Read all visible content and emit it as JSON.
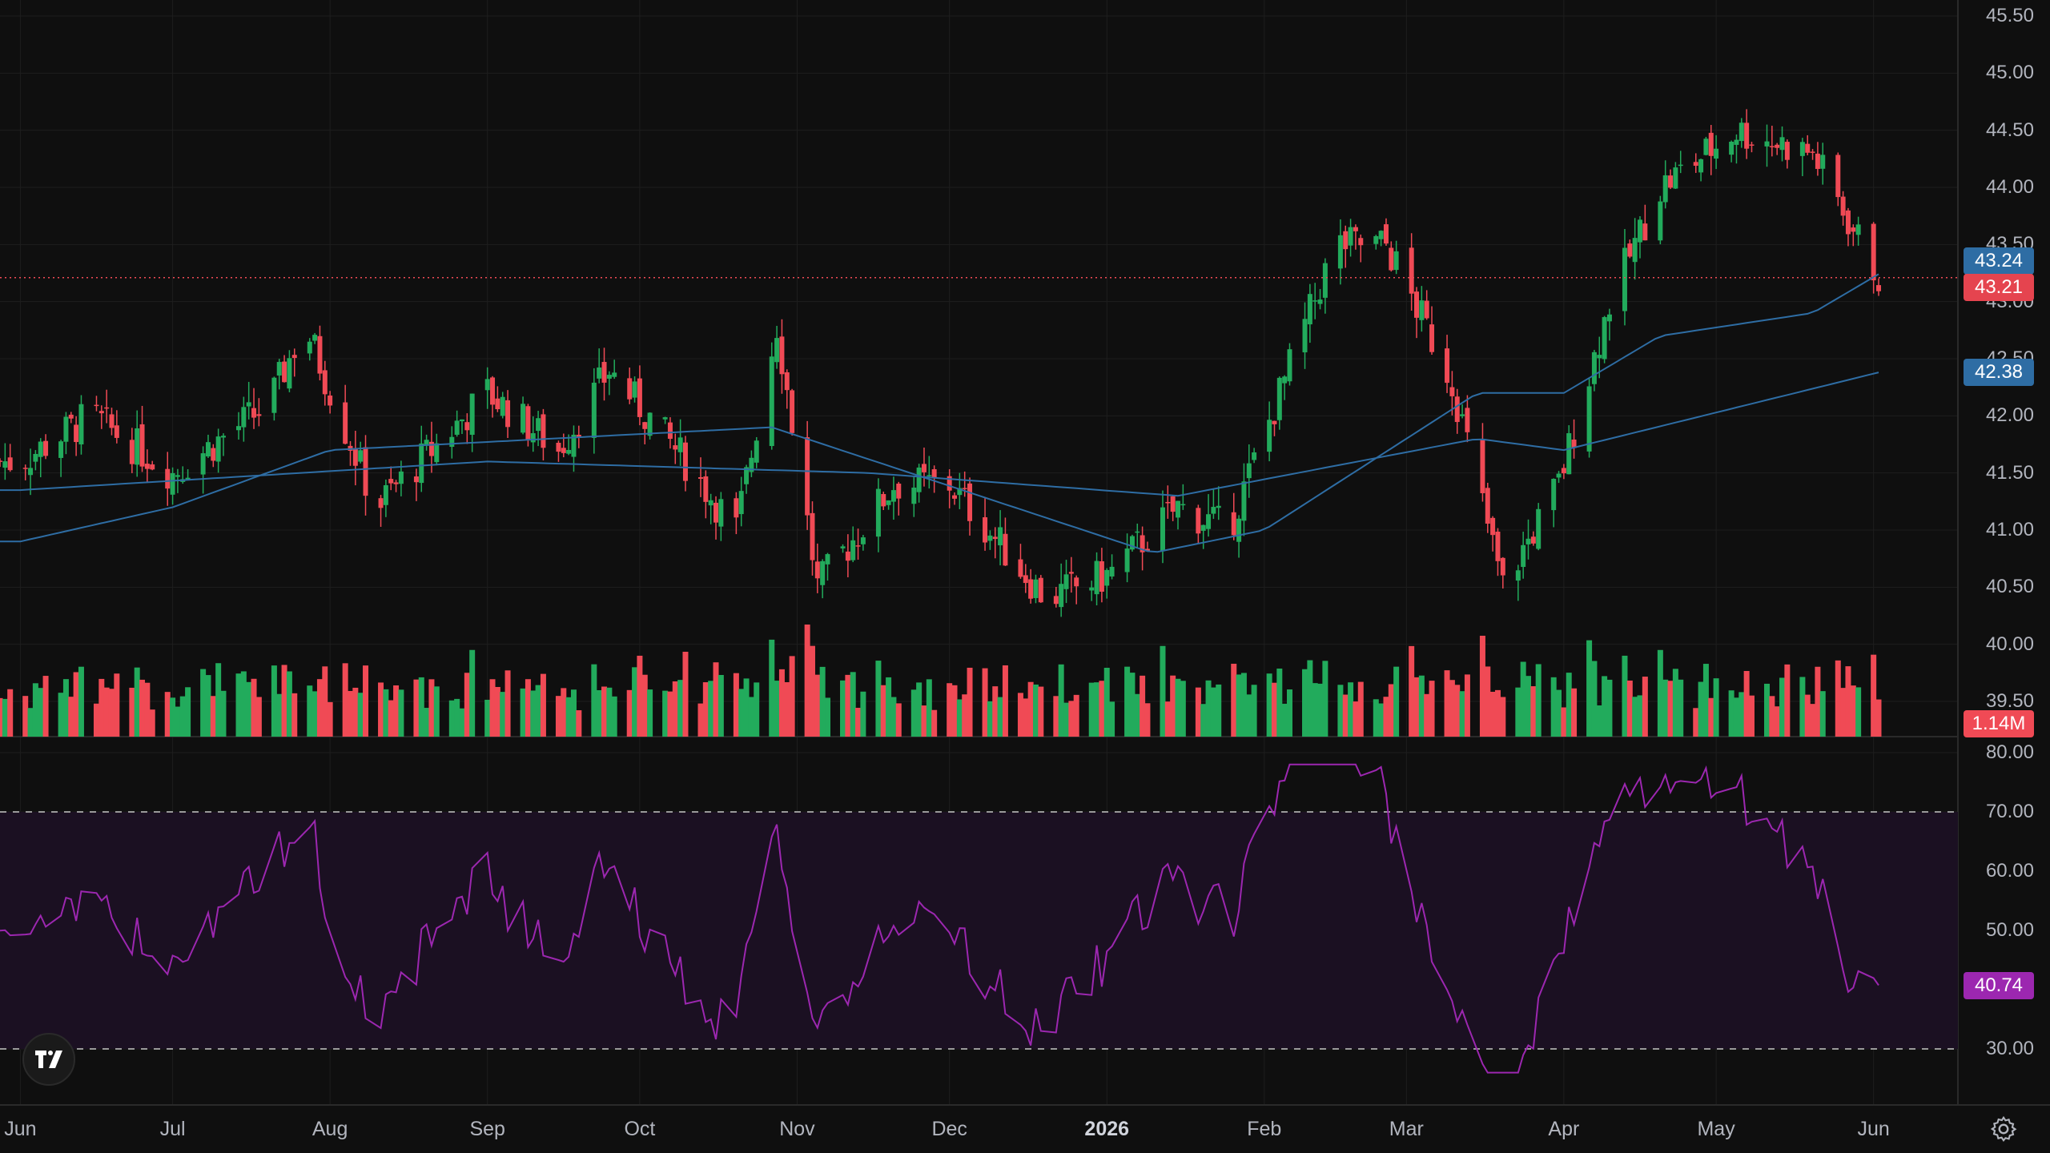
{
  "chart_data": [
    {
      "type": "candlestick",
      "title": "",
      "ylim": [
        39.2,
        45.6
      ],
      "y_ticks": [
        "45.50",
        "45.00",
        "44.50",
        "44.00",
        "43.50",
        "43.00",
        "42.50",
        "42.00",
        "41.50",
        "41.00",
        "40.50",
        "40.00",
        "39.50"
      ],
      "x_ticks": [
        "Jun",
        "Jul",
        "Aug",
        "Sep",
        "Oct",
        "Nov",
        "Dec",
        "2026",
        "Feb",
        "Mar",
        "Apr",
        "May",
        "Jun"
      ],
      "close_series_anchors": [
        {
          "date": "2025-06-01",
          "close": 41.6
        },
        {
          "date": "2025-06-15",
          "close": 42.0
        },
        {
          "date": "2025-07-01",
          "close": 41.5
        },
        {
          "date": "2025-07-20",
          "close": 42.1
        },
        {
          "date": "2025-07-27",
          "close": 42.8
        },
        {
          "date": "2025-08-10",
          "close": 41.2
        },
        {
          "date": "2025-09-01",
          "close": 42.2
        },
        {
          "date": "2025-09-15",
          "close": 41.7
        },
        {
          "date": "2025-09-25",
          "close": 42.4
        },
        {
          "date": "2025-10-10",
          "close": 41.6
        },
        {
          "date": "2025-10-20",
          "close": 41.0
        },
        {
          "date": "2025-10-28",
          "close": 42.8
        },
        {
          "date": "2025-11-05",
          "close": 40.5
        },
        {
          "date": "2025-11-20",
          "close": 41.4
        },
        {
          "date": "2025-12-01",
          "close": 41.4
        },
        {
          "date": "2025-12-20",
          "close": 40.4
        },
        {
          "date": "2026-01-01",
          "close": 40.6
        },
        {
          "date": "2026-01-15",
          "close": 41.2
        },
        {
          "date": "2026-01-25",
          "close": 41.0
        },
        {
          "date": "2026-02-15",
          "close": 43.5
        },
        {
          "date": "2026-02-25",
          "close": 43.5
        },
        {
          "date": "2026-03-10",
          "close": 42.3
        },
        {
          "date": "2026-03-20",
          "close": 40.5
        },
        {
          "date": "2026-03-31",
          "close": 41.4
        },
        {
          "date": "2026-04-10",
          "close": 43.0
        },
        {
          "date": "2026-04-20",
          "close": 44.0
        },
        {
          "date": "2026-05-05",
          "close": 44.5
        },
        {
          "date": "2026-05-20",
          "close": 44.3
        },
        {
          "date": "2026-06-02",
          "close": 43.21
        }
      ],
      "ma_fast_anchors": [
        {
          "date": "2025-06-01",
          "value": 40.9
        },
        {
          "date": "2025-07-01",
          "value": 41.2
        },
        {
          "date": "2025-08-01",
          "value": 41.7
        },
        {
          "date": "2025-10-27",
          "value": 41.9
        },
        {
          "date": "2026-01-10",
          "value": 40.8
        },
        {
          "date": "2026-02-01",
          "value": 41.0
        },
        {
          "date": "2026-03-15",
          "value": 42.2
        },
        {
          "date": "2026-04-01",
          "value": 42.2
        },
        {
          "date": "2026-04-20",
          "value": 42.7
        },
        {
          "date": "2026-05-20",
          "value": 42.9
        },
        {
          "date": "2026-06-02",
          "value": 43.24
        }
      ],
      "ma_slow_anchors": [
        {
          "date": "2025-06-01",
          "value": 41.35
        },
        {
          "date": "2025-09-01",
          "value": 41.6
        },
        {
          "date": "2025-11-15",
          "value": 41.5
        },
        {
          "date": "2026-01-15",
          "value": 41.3
        },
        {
          "date": "2026-03-15",
          "value": 41.8
        },
        {
          "date": "2026-04-01",
          "value": 41.7
        },
        {
          "date": "2026-06-02",
          "value": 42.38
        }
      ],
      "badges": [
        {
          "label": "43.24",
          "color": "#2e6da4",
          "value": 43.24
        },
        {
          "label": "43.21",
          "color": "#e5444f",
          "value": 43.21
        },
        {
          "label": "42.38",
          "color": "#2e6da4",
          "value": 42.38
        }
      ],
      "last_price": 43.21
    },
    {
      "type": "bar",
      "name": "Volume",
      "last_value_label": "1.14M",
      "up_color": "#22ab5c",
      "down_color": "#f04a55"
    },
    {
      "type": "line",
      "name": "RSI",
      "ylim": [
        25,
        82
      ],
      "y_ticks": [
        "80.00",
        "70.00",
        "60.00",
        "50.00",
        "40.00",
        "30.00"
      ],
      "upper_band": 70,
      "lower_band": 30,
      "last_value": 40.74,
      "last_value_label": "40.74",
      "color": "#9c27b0"
    }
  ],
  "colors": {
    "background": "#0f0f0f",
    "up": "#22ab5c",
    "down": "#f04a55",
    "rsi_line": "#9c27b0",
    "rsi_band": "#1b1022",
    "ma": "#2e6da4"
  },
  "icons": {
    "logo": "tradingview-logo-icon",
    "settings": "gear-icon"
  }
}
